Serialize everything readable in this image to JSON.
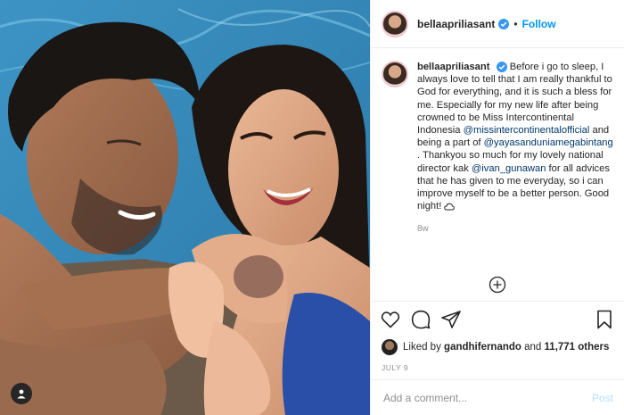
{
  "post": {
    "username": "bellaapriliasant",
    "follow_label": "Follow",
    "separator": "•",
    "caption": {
      "username": "bellaapriliasant",
      "text_1": "Before i go to sleep, I always love to tell that I am really thankful to God for everything, and it is such a bless for me. Especially for my new life after being crowned to be Miss Intercontinental Indonesia ",
      "mention_1": "@missintercontinentalofficial",
      "text_2": " and being a part of ",
      "mention_2": "@yayasanduniamegabintang",
      "text_3": " . Thankyou so much for my lovely national director kak ",
      "mention_3": "@ivan_gunawan",
      "text_4": " for all advices that he has given to me everyday, so i can improve myself to be a better person. Good night!",
      "emoji": "cloud-emoji",
      "age": "8w"
    },
    "likes": {
      "prefix": "Liked by ",
      "user": "gandhifernando",
      "middle": " and ",
      "count": "11,771 others"
    },
    "date": "JULY 9",
    "comment": {
      "placeholder": "Add a comment...",
      "post_label": "Post"
    },
    "icons": [
      "heart-icon",
      "comment-icon",
      "share-icon",
      "bookmark-icon",
      "user-tag-icon",
      "load-more-icon",
      "verified-badge-icon"
    ],
    "colors": {
      "link": "#0095f6",
      "mention": "#00376b",
      "muted": "#8e8e8e",
      "post_disabled": "#b2dffc",
      "verified": "#3897f0"
    }
  }
}
